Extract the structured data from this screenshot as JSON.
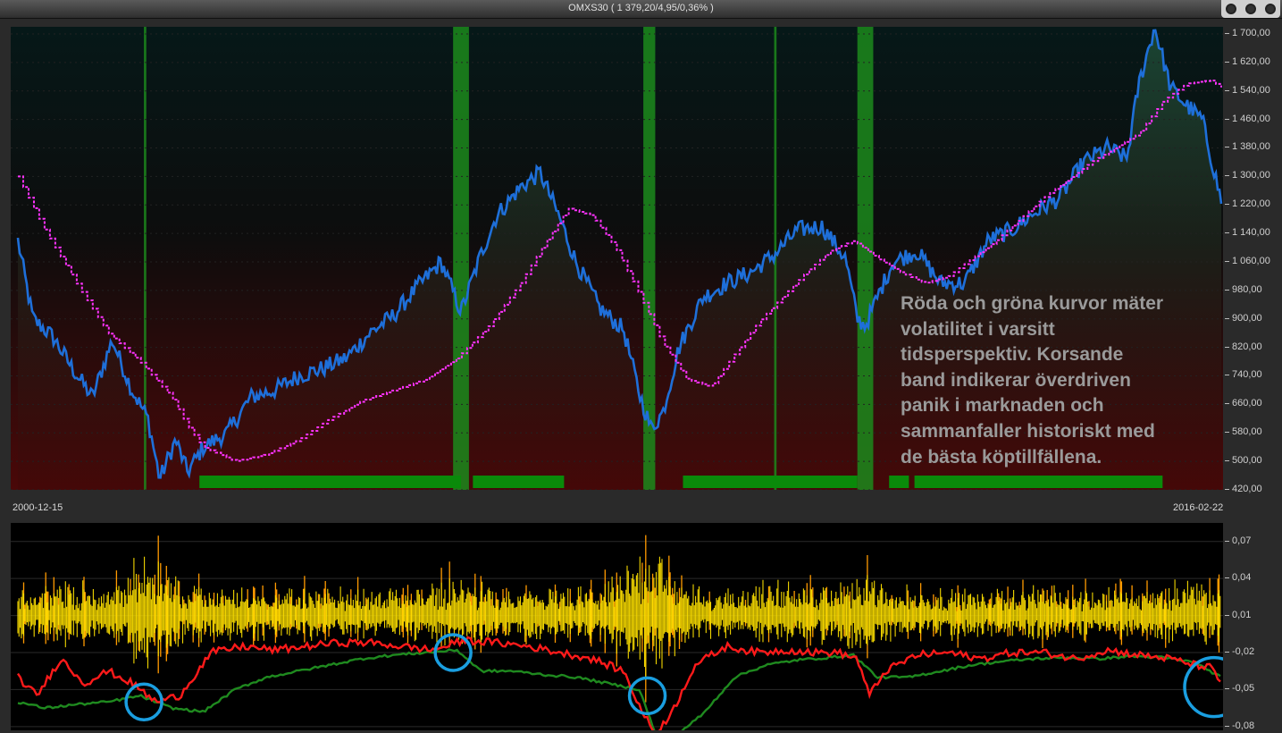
{
  "window": {
    "title": "OMXS30 ( 1 379,20/4,95/0,36% )"
  },
  "annotation": {
    "line1": "Röda och gröna kurvor mäter",
    "line2": "volatilitet i varsitt",
    "line3": "tidsperspektiv. Korsande",
    "line4": "band indikerar överdriven",
    "line5": "panik i marknaden och",
    "line6": "sammanfaller historiskt med",
    "line7": "de bästa köptillfällena."
  },
  "dates": {
    "start": "2000-12-15",
    "end": "2016-02-22"
  },
  "colors": {
    "price": "#1e6fd9",
    "moving_average": "#ff33ff",
    "signal_bands": "#1c8a1c",
    "bottom_bars": "#0a8a0a",
    "volatility_bars": "#ffe200",
    "volatility_bars_edge": "#ff9a00",
    "red_curve": "#ff1a1a",
    "green_curve": "#1f8a1f",
    "circles": "#1a9ee0"
  },
  "chart_data": [
    {
      "type": "line",
      "name": "OMXS30 price panel",
      "x_range": [
        "2000-12-15",
        "2016-02-22"
      ],
      "ylim": [
        420,
        1720
      ],
      "y_ticks": [
        "1 700,00",
        "1 620,00",
        "1 540,00",
        "1 460,00",
        "1 380,00",
        "1 300,00",
        "1 220,00",
        "1 140,00",
        "1 060,00",
        "980,00",
        "900,00",
        "820,00",
        "740,00",
        "660,00",
        "580,00",
        "500,00",
        "420,00"
      ],
      "y_tick_values": [
        1700,
        1620,
        1540,
        1460,
        1380,
        1300,
        1220,
        1140,
        1060,
        980,
        900,
        820,
        740,
        660,
        580,
        500,
        420
      ],
      "series": [
        {
          "key": "price",
          "x": [
            2000.96,
            2001.15,
            2001.4,
            2001.65,
            2001.9,
            2002.15,
            2002.4,
            2002.6,
            2002.75,
            2002.95,
            2003.1,
            2003.3,
            2003.6,
            2003.9,
            2004.2,
            2004.5,
            2004.8,
            2005.1,
            2005.4,
            2005.7,
            2006.0,
            2006.3,
            2006.55,
            2006.8,
            2007.0,
            2007.3,
            2007.55,
            2007.8,
            2008.0,
            2008.3,
            2008.6,
            2008.8,
            2008.95,
            2009.1,
            2009.3,
            2009.6,
            2009.9,
            2010.2,
            2010.5,
            2010.8,
            2011.1,
            2011.4,
            2011.55,
            2011.65,
            2011.8,
            2012.0,
            2012.3,
            2012.6,
            2012.9,
            2013.2,
            2013.5,
            2013.8,
            2014.1,
            2014.4,
            2014.7,
            2014.95,
            2015.1,
            2015.3,
            2015.5,
            2015.7,
            2015.9,
            2016.14
          ],
          "y": [
            1120,
            900,
            850,
            760,
            680,
            840,
            700,
            620,
            450,
            560,
            470,
            540,
            580,
            680,
            700,
            740,
            760,
            790,
            860,
            910,
            990,
            1060,
            920,
            1080,
            1190,
            1270,
            1310,
            1180,
            1060,
            930,
            870,
            690,
            590,
            640,
            820,
            960,
            1000,
            1030,
            1080,
            1150,
            1160,
            1070,
            900,
            880,
            960,
            1060,
            1090,
            1000,
            1000,
            1120,
            1150,
            1200,
            1240,
            1340,
            1380,
            1350,
            1560,
            1720,
            1550,
            1500,
            1460,
            1230
          ]
        },
        {
          "key": "moving_average",
          "x": [
            2000.96,
            2001.3,
            2001.7,
            2002.1,
            2002.5,
            2002.9,
            2003.1,
            2003.3,
            2003.7,
            2004.1,
            2004.5,
            2004.9,
            2005.3,
            2005.7,
            2006.1,
            2006.5,
            2006.9,
            2007.3,
            2007.6,
            2007.9,
            2008.2,
            2008.5,
            2008.8,
            2009.1,
            2009.4,
            2009.7,
            2010.0,
            2010.3,
            2010.6,
            2010.9,
            2011.2,
            2011.5,
            2011.8,
            2012.1,
            2012.4,
            2012.7,
            2013.0,
            2013.3,
            2013.6,
            2013.9,
            2014.2,
            2014.5,
            2014.8,
            2015.1,
            2015.4,
            2015.7,
            2016.0,
            2016.14
          ],
          "y": [
            1300,
            1150,
            1000,
            860,
            780,
            680,
            600,
            540,
            500,
            520,
            560,
            620,
            670,
            700,
            730,
            790,
            880,
            1000,
            1110,
            1210,
            1190,
            1100,
            970,
            830,
            730,
            710,
            800,
            890,
            960,
            1030,
            1090,
            1120,
            1070,
            1030,
            1000,
            1020,
            1070,
            1120,
            1180,
            1240,
            1290,
            1340,
            1380,
            1420,
            1510,
            1560,
            1570,
            1550
          ]
        }
      ],
      "signal_bands": [
        {
          "from": 2002.55,
          "to": 2002.58
        },
        {
          "from": 2006.45,
          "to": 2006.65
        },
        {
          "from": 2008.85,
          "to": 2009.0
        },
        {
          "from": 2010.5,
          "to": 2010.53
        },
        {
          "from": 2011.55,
          "to": 2011.75
        }
      ],
      "bottom_bars": [
        {
          "from": 2003.25,
          "to": 2006.55
        },
        {
          "from": 2006.7,
          "to": 2007.85
        },
        {
          "from": 2009.35,
          "to": 2011.55
        },
        {
          "from": 2011.95,
          "to": 2012.2
        },
        {
          "from": 2012.27,
          "to": 2015.4
        }
      ]
    },
    {
      "type": "line",
      "name": "volatility panel",
      "x_range": [
        "2000-12-15",
        "2016-02-22"
      ],
      "ylim": [
        -0.083,
        0.085
      ],
      "y_ticks": [
        "0,07",
        "0,04",
        "0,01",
        "-0,02",
        "-0,05",
        "-0,08"
      ],
      "y_tick_values": [
        0.07,
        0.04,
        0.01,
        -0.02,
        -0.05,
        -0.08
      ],
      "series": [
        {
          "key": "red_curve",
          "x": [
            2000.96,
            2001.2,
            2001.5,
            2001.8,
            2002.1,
            2002.4,
            2002.7,
            2003.0,
            2003.4,
            2003.8,
            2004.2,
            2004.6,
            2005.0,
            2005.4,
            2005.8,
            2006.2,
            2006.6,
            2007.0,
            2007.4,
            2007.8,
            2008.2,
            2008.6,
            2008.85,
            2009.0,
            2009.2,
            2009.5,
            2009.9,
            2010.3,
            2010.7,
            2011.0,
            2011.3,
            2011.55,
            2011.7,
            2011.9,
            2012.3,
            2012.7,
            2013.1,
            2013.5,
            2013.9,
            2014.3,
            2014.7,
            2015.1,
            2015.5,
            2015.8,
            2016.0,
            2016.14
          ],
          "y": [
            -0.04,
            -0.055,
            -0.025,
            -0.045,
            -0.035,
            -0.045,
            -0.06,
            -0.055,
            -0.02,
            -0.015,
            -0.018,
            -0.015,
            -0.012,
            -0.012,
            -0.015,
            -0.018,
            -0.01,
            -0.012,
            -0.015,
            -0.02,
            -0.025,
            -0.035,
            -0.07,
            -0.085,
            -0.07,
            -0.03,
            -0.015,
            -0.02,
            -0.018,
            -0.02,
            -0.02,
            -0.025,
            -0.055,
            -0.035,
            -0.022,
            -0.02,
            -0.025,
            -0.02,
            -0.02,
            -0.025,
            -0.018,
            -0.022,
            -0.025,
            -0.03,
            -0.032,
            -0.045
          ]
        },
        {
          "key": "green_curve",
          "x": [
            2000.96,
            2001.3,
            2001.7,
            2002.1,
            2002.5,
            2002.9,
            2003.3,
            2003.7,
            2004.1,
            2004.5,
            2004.9,
            2005.3,
            2005.7,
            2006.1,
            2006.5,
            2006.8,
            2007.2,
            2007.6,
            2008.0,
            2008.4,
            2008.8,
            2009.0,
            2009.2,
            2009.6,
            2010.0,
            2010.4,
            2010.8,
            2011.2,
            2011.5,
            2011.8,
            2012.2,
            2012.6,
            2013.0,
            2013.4,
            2013.8,
            2014.2,
            2014.6,
            2015.0,
            2015.4,
            2015.8,
            2016.14
          ],
          "y": [
            -0.06,
            -0.065,
            -0.062,
            -0.06,
            -0.055,
            -0.065,
            -0.068,
            -0.05,
            -0.04,
            -0.035,
            -0.03,
            -0.025,
            -0.022,
            -0.02,
            -0.018,
            -0.035,
            -0.035,
            -0.038,
            -0.04,
            -0.045,
            -0.05,
            -0.085,
            -0.09,
            -0.07,
            -0.04,
            -0.03,
            -0.026,
            -0.024,
            -0.022,
            -0.04,
            -0.04,
            -0.035,
            -0.03,
            -0.027,
            -0.025,
            -0.024,
            -0.025,
            -0.023,
            -0.024,
            -0.028,
            -0.04
          ]
        }
      ],
      "highlights": [
        {
          "x": 2002.55,
          "y": -0.06
        },
        {
          "x": 2006.45,
          "y": -0.02
        },
        {
          "x": 2008.9,
          "y": -0.055
        },
        {
          "x": 2016.05,
          "y": -0.048
        }
      ]
    }
  ]
}
